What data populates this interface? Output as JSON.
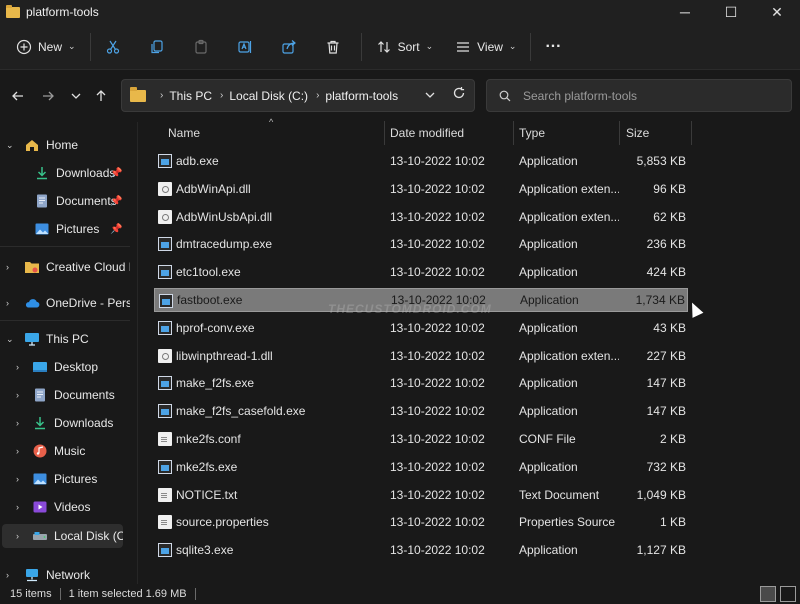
{
  "window": {
    "title": "platform-tools",
    "controls": [
      "─",
      "☐",
      "✕"
    ]
  },
  "commands": {
    "new_label": "New",
    "sort_label": "Sort",
    "view_label": "View",
    "more_label": "···"
  },
  "address": {
    "crumbs": [
      "This PC",
      "Local Disk (C:)",
      "platform-tools"
    ],
    "search_placeholder": "Search platform-tools"
  },
  "sidebar": {
    "home": "Home",
    "quick": [
      {
        "label": "Downloads",
        "icon": "download-icon"
      },
      {
        "label": "Documents",
        "icon": "documents-icon"
      },
      {
        "label": "Pictures",
        "icon": "pictures-icon"
      }
    ],
    "creative_cloud": "Creative Cloud F",
    "onedrive": "OneDrive - Perso",
    "this_pc": "This PC",
    "pc_items": [
      {
        "label": "Desktop",
        "icon": "desktop-icon"
      },
      {
        "label": "Documents",
        "icon": "documents-icon"
      },
      {
        "label": "Downloads",
        "icon": "download-icon"
      },
      {
        "label": "Music",
        "icon": "music-icon"
      },
      {
        "label": "Pictures",
        "icon": "pictures-icon"
      },
      {
        "label": "Videos",
        "icon": "videos-icon"
      },
      {
        "label": "Local Disk (C:)",
        "icon": "drive-icon"
      }
    ],
    "network": "Network"
  },
  "columns": {
    "name": "Name",
    "date": "Date modified",
    "type": "Type",
    "size": "Size"
  },
  "files": [
    {
      "name": "adb.exe",
      "date": "13-10-2022 10:02",
      "type": "Application",
      "size": "5,853 KB",
      "kind": "exe"
    },
    {
      "name": "AdbWinApi.dll",
      "date": "13-10-2022 10:02",
      "type": "Application exten...",
      "size": "96 KB",
      "kind": "dll"
    },
    {
      "name": "AdbWinUsbApi.dll",
      "date": "13-10-2022 10:02",
      "type": "Application exten...",
      "size": "62 KB",
      "kind": "dll"
    },
    {
      "name": "dmtracedump.exe",
      "date": "13-10-2022 10:02",
      "type": "Application",
      "size": "236 KB",
      "kind": "exe"
    },
    {
      "name": "etc1tool.exe",
      "date": "13-10-2022 10:02",
      "type": "Application",
      "size": "424 KB",
      "kind": "exe"
    },
    {
      "name": "fastboot.exe",
      "date": "13-10-2022 10:02",
      "type": "Application",
      "size": "1,734 KB",
      "kind": "exe",
      "selected": true
    },
    {
      "name": "hprof-conv.exe",
      "date": "13-10-2022 10:02",
      "type": "Application",
      "size": "43 KB",
      "kind": "exe"
    },
    {
      "name": "libwinpthread-1.dll",
      "date": "13-10-2022 10:02",
      "type": "Application exten...",
      "size": "227 KB",
      "kind": "dll"
    },
    {
      "name": "make_f2fs.exe",
      "date": "13-10-2022 10:02",
      "type": "Application",
      "size": "147 KB",
      "kind": "exe"
    },
    {
      "name": "make_f2fs_casefold.exe",
      "date": "13-10-2022 10:02",
      "type": "Application",
      "size": "147 KB",
      "kind": "exe"
    },
    {
      "name": "mke2fs.conf",
      "date": "13-10-2022 10:02",
      "type": "CONF File",
      "size": "2 KB",
      "kind": "doc"
    },
    {
      "name": "mke2fs.exe",
      "date": "13-10-2022 10:02",
      "type": "Application",
      "size": "732 KB",
      "kind": "exe"
    },
    {
      "name": "NOTICE.txt",
      "date": "13-10-2022 10:02",
      "type": "Text Document",
      "size": "1,049 KB",
      "kind": "doc"
    },
    {
      "name": "source.properties",
      "date": "13-10-2022 10:02",
      "type": "Properties Source ...",
      "size": "1 KB",
      "kind": "doc"
    },
    {
      "name": "sqlite3.exe",
      "date": "13-10-2022 10:02",
      "type": "Application",
      "size": "1,127 KB",
      "kind": "exe"
    }
  ],
  "watermark": "THECUSTOMDROID.COM",
  "status": {
    "count": "15 items",
    "selection": "1 item selected  1.69 MB"
  }
}
